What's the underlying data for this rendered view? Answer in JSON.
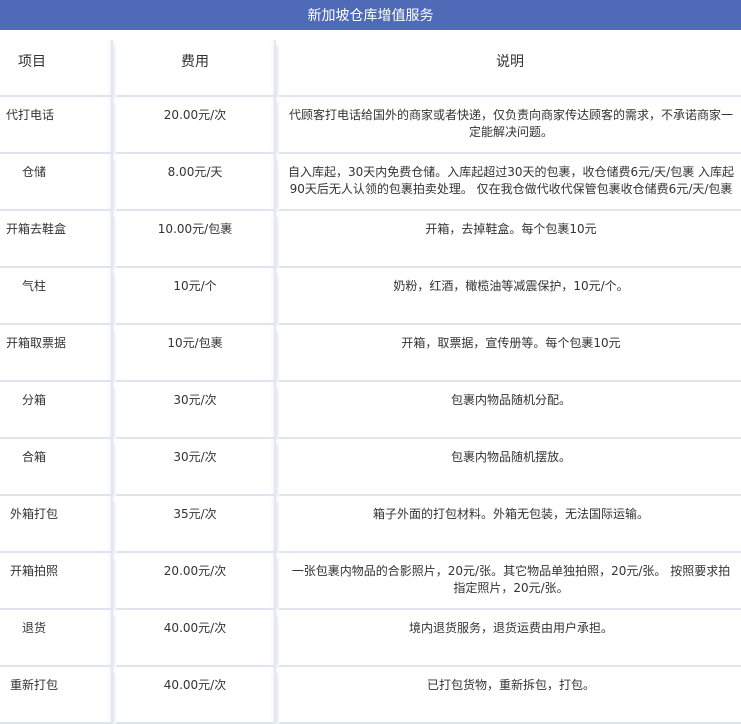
{
  "title": "新加坡仓库增值服务",
  "headers": {
    "item": "项目",
    "fee": "费用",
    "desc": "说明"
  },
  "rows": [
    {
      "item": "代打电话",
      "fee": "20.00元/次",
      "desc": "代顾客打电话给国外的商家或者快递，仅负责向商家传达顾客的需求，不承诺商家一定能解决问题。"
    },
    {
      "item": "仓储",
      "fee": "8.00元/天",
      "desc": "自入库起，30天内免费仓储。入库起超过30天的包裹，收仓储费6元/天/包裹 入库起90天后无人认领的包裹拍卖处理。 仅在我仓做代收代保管包裹收仓储费6元/天/包裹"
    },
    {
      "item": "开箱去鞋盒",
      "fee": "10.00元/包裹",
      "desc": "开箱，去掉鞋盒。每个包裹10元"
    },
    {
      "item": "气柱",
      "fee": "10元/个",
      "desc": "奶粉，红酒，橄榄油等减震保护，10元/个。"
    },
    {
      "item": "开箱取票据",
      "fee": "10元/包裹",
      "desc": "开箱，取票据，宣传册等。每个包裹10元"
    },
    {
      "item": "分箱",
      "fee": "30元/次",
      "desc": "包裹内物品随机分配。"
    },
    {
      "item": "合箱",
      "fee": "30元/次",
      "desc": "包裹内物品随机摆放。"
    },
    {
      "item": "外箱打包",
      "fee": "35元/次",
      "desc": "箱子外面的打包材料。外箱无包装，无法国际运输。"
    },
    {
      "item": "开箱拍照",
      "fee": "20.00元/次",
      "desc": "一张包裹内物品的合影照片，20元/张。其它物品单独拍照，20元/张。 按照要求拍指定照片，20元/张。"
    },
    {
      "item": "退货",
      "fee": "40.00元/次",
      "desc": "境内退货服务，退货运费由用户承担。"
    },
    {
      "item": "重新打包",
      "fee": "40.00元/次",
      "desc": "已打包货物，重新拆包，打包。"
    }
  ]
}
